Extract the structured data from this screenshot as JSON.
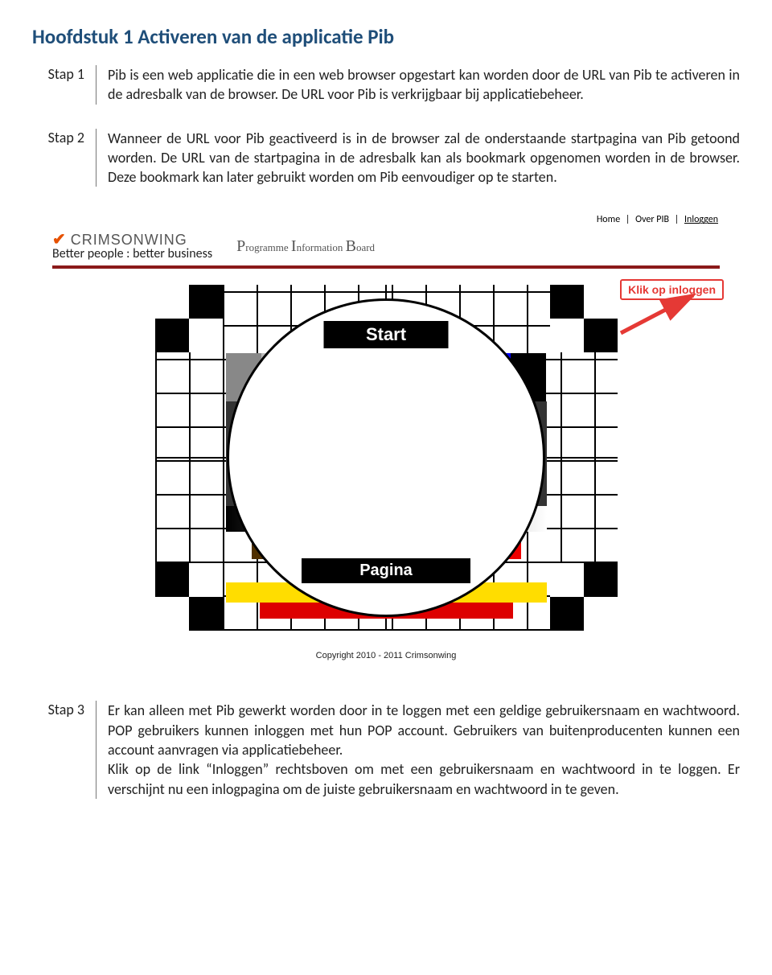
{
  "heading": "Hoofdstuk 1 Activeren van de applicatie  Pib",
  "steps": {
    "s1": {
      "label": "Stap 1",
      "text": "Pib is een web applicatie die in een web browser opgestart kan worden door de URL van Pib te activeren in de adresbalk van de browser. De URL voor Pib is verkrijgbaar bij applicatiebeheer."
    },
    "s2": {
      "label": "Stap 2",
      "text": "Wanneer de URL voor Pib geactiveerd is in de browser zal de onderstaande startpagina van Pib getoond worden. De URL van de startpagina in de adresbalk kan als bookmark opgenomen worden in de browser. Deze bookmark kan later gebruikt worden om Pib eenvoudiger op te starten."
    },
    "s3": {
      "label": "Stap 3",
      "text": "Er kan alleen met Pib gewerkt worden door in te loggen met een geldige gebruikersnaam en wachtwoord. POP gebruikers kunnen inloggen met hun POP account. Gebruikers van buitenproducenten kunnen een account aanvragen via applicatiebeheer.\nKlik op de link “Inloggen” rechtsboven om met een gebruikersnaam en wachtwoord in te loggen. Er verschijnt nu een inlogpagina om de juiste gebruikersnaam en wachtwoord in te geven."
    }
  },
  "screenshot": {
    "nav": {
      "home": "Home",
      "over": "Over PIB",
      "inloggen": "Inloggen"
    },
    "brand": {
      "name": "CRIMSONWING",
      "tagline": "Better people : better business"
    },
    "pib": {
      "p": "P",
      "p2": "rogramme",
      "i": "I",
      "i2": "nformation",
      "b": "B",
      "b2": "oard"
    },
    "card": {
      "start": "Start",
      "pagina": "Pagina"
    },
    "copyright": "Copyright 2010 - 2011 Crimsonwing",
    "callout": "Klik op inloggen"
  }
}
